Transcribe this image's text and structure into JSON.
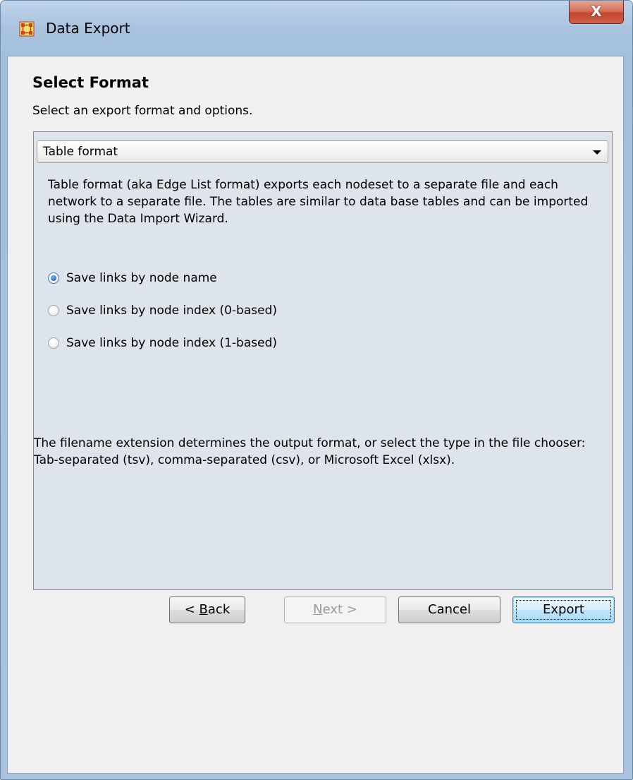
{
  "window": {
    "title": "Data Export",
    "close_label": "X",
    "app_icon": "ora-network-icon"
  },
  "page": {
    "heading": "Select Format",
    "subheading": "Select an export format and options."
  },
  "format_select": {
    "selected": "Table format"
  },
  "panel": {
    "description": "Table format (aka Edge List format) exports each nodeset to a separate file and each network to a separate file. The tables are similar to data base tables and can be imported using the Data Import Wizard.",
    "options": [
      {
        "label": "Save links by node name",
        "checked": true
      },
      {
        "label": "Save links by node index (0-based)",
        "checked": false
      },
      {
        "label": "Save links by node index (1-based)",
        "checked": false
      }
    ],
    "footer": "The filename extension determines the output format, or select the type in the file chooser: Tab-separated (tsv), comma-separated (csv), or Microsoft Excel (xlsx)."
  },
  "buttons": {
    "back_prefix": "< ",
    "back_mnemonic": "B",
    "back_rest": "ack",
    "next_mnemonic": "N",
    "next_rest": "ext >",
    "cancel": "Cancel",
    "export": "Export"
  },
  "colors": {
    "title_bar": "#a9c3df",
    "close_button": "#c4452d",
    "panel_background": "#dee4ec",
    "dialog_background": "#f0f0f0"
  }
}
